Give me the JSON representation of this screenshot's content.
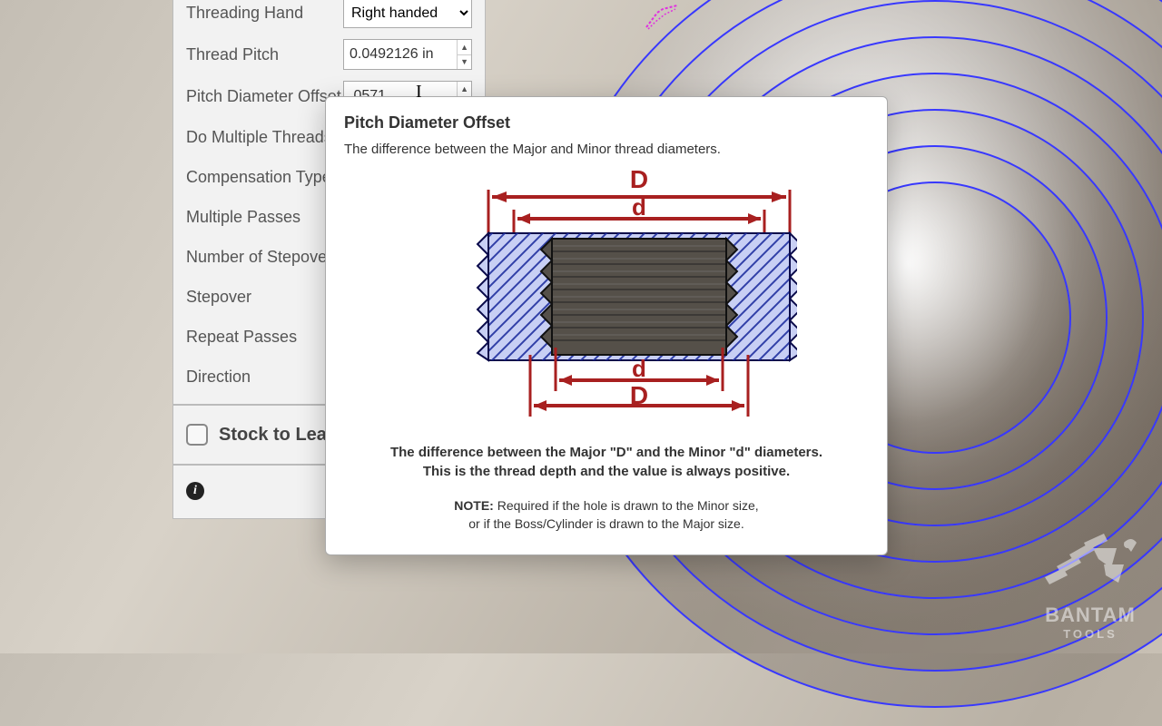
{
  "panel": {
    "threading_hand": {
      "label": "Threading Hand",
      "value": "Right handed"
    },
    "thread_pitch": {
      "label": "Thread Pitch",
      "value": "0.0492126 in"
    },
    "pitch_offset": {
      "label": "Pitch Diameter Offset",
      "value": ".0571"
    },
    "do_multiple": {
      "label": "Do Multiple Threads"
    },
    "comp_type": {
      "label": "Compensation Type"
    },
    "multi_passes": {
      "label": "Multiple Passes"
    },
    "stepovers": {
      "label": "Number of Stepovers"
    },
    "stepover": {
      "label": "Stepover"
    },
    "repeat": {
      "label": "Repeat Passes"
    },
    "direction": {
      "label": "Direction"
    },
    "stock": {
      "label": "Stock to Leave"
    }
  },
  "tooltip": {
    "title": "Pitch Diameter Offset",
    "desc": "The difference between the Major and Minor thread diameters.",
    "caption1": "The difference between the Major \"D\" and the Minor \"d\" diameters.",
    "caption2": "This is the thread depth and the value is always positive.",
    "note_label": "NOTE:",
    "note1": "Required if the hole is drawn to the Minor size,",
    "note2": "or if the Boss/Cylinder is drawn to the Major size.",
    "dim": {
      "D_upper": "D",
      "d_upper": "d",
      "d_lower": "d",
      "D_lower": "D"
    }
  },
  "watermark": {
    "line1": "BANTAM",
    "line2": "TOOLS"
  }
}
